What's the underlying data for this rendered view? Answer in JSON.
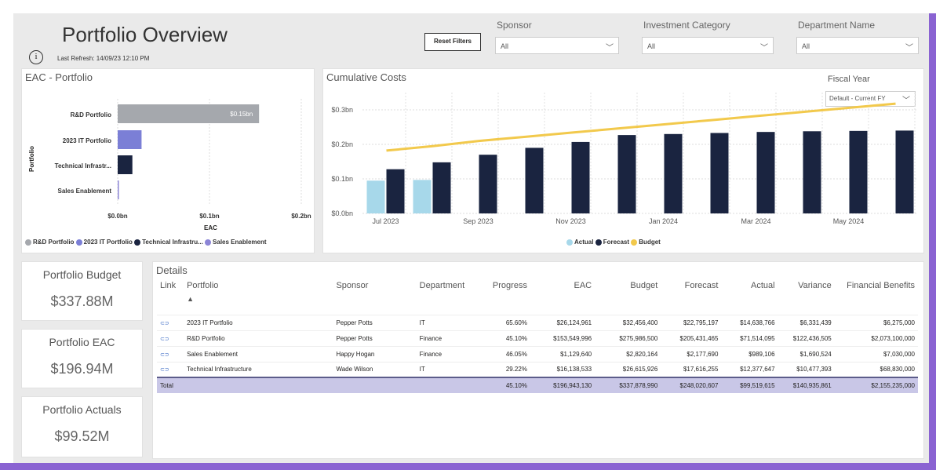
{
  "header": {
    "title": "Portfolio Overview",
    "last_refresh": "Last Refresh: 14/09/23 12:10 PM",
    "reset_label": "Reset Filters"
  },
  "slicers": [
    {
      "label": "Sponsor",
      "value": "All"
    },
    {
      "label": "Investment Category",
      "value": "All"
    },
    {
      "label": "Department Name",
      "value": "All"
    }
  ],
  "eac_panel": {
    "title": "EAC - Portfolio",
    "y_title": "Portfolio",
    "x_title": "EAC",
    "bar_label": "$0.15bn"
  },
  "cumulative_panel": {
    "title": "Cumulative Costs",
    "fiscal_label": "Fiscal Year",
    "fiscal_value": "Default - Current FY"
  },
  "kpis": [
    {
      "label": "Portfolio Budget",
      "value": "$337.88M"
    },
    {
      "label": "Portfolio EAC",
      "value": "$196.94M"
    },
    {
      "label": "Portfolio Actuals",
      "value": "$99.52M"
    }
  ],
  "details": {
    "title": "Details",
    "sort_arrow": "▲",
    "columns": [
      "Link",
      "Portfolio",
      "Sponsor",
      "Department",
      "Progress",
      "EAC",
      "Budget",
      "Forecast",
      "Actual",
      "Variance",
      "Financial Benefits"
    ],
    "rows": [
      [
        "2023 IT Portfolio",
        "Pepper Potts",
        "IT",
        "65.60%",
        "$26,124,961",
        "$32,456,400",
        "$22,795,197",
        "$14,638,766",
        "$6,331,439",
        "$6,275,000"
      ],
      [
        "R&D Portfolio",
        "Pepper Potts",
        "Finance",
        "45.10%",
        "$153,549,996",
        "$275,986,500",
        "$205,431,465",
        "$71,514,095",
        "$122,436,505",
        "$2,073,100,000"
      ],
      [
        "Sales Enablement",
        "Happy Hogan",
        "Finance",
        "46.05%",
        "$1,129,640",
        "$2,820,164",
        "$2,177,690",
        "$989,106",
        "$1,690,524",
        "$7,030,000"
      ],
      [
        "Technical Infrastructure",
        "Wade Wilson",
        "IT",
        "29.22%",
        "$16,138,533",
        "$26,615,926",
        "$17,616,255",
        "$12,377,647",
        "$10,477,393",
        "$68,830,000"
      ]
    ],
    "total": [
      "Total",
      "",
      "",
      "45.10%",
      "$196,943,130",
      "$337,878,990",
      "$248,020,607",
      "$99,519,615",
      "$140,935,861",
      "$2,155,235,000"
    ]
  },
  "colors": {
    "rd": "#a5a8ad",
    "it2023": "#7b7fd6",
    "tech": "#1a2440",
    "sales": "#8c85d6",
    "actual": "#a7d8ea",
    "forecast": "#1a2440",
    "budget": "#f2c94c"
  },
  "chart_data": [
    {
      "type": "bar",
      "orientation": "horizontal",
      "title": "EAC - Portfolio",
      "xlabel": "EAC",
      "ylabel": "Portfolio",
      "categories": [
        "R&D Portfolio",
        "2023 IT Portfolio",
        "Technical Infrastr...",
        "Sales Enablement"
      ],
      "values": [
        0.154,
        0.026,
        0.016,
        0.001
      ],
      "xticks": [
        "$0.0bn",
        "$0.1bn",
        "$0.2bn"
      ],
      "xlim": [
        0,
        0.2
      ],
      "legend": [
        "R&D Portfolio",
        "2023 IT Portfolio",
        "Technical Infrastru...",
        "Sales Enablement"
      ],
      "legend_placement": "bottom"
    },
    {
      "type": "bar",
      "title": "Cumulative Costs",
      "categories": [
        "Jul 2023",
        "Aug 2023",
        "Sep 2023",
        "Oct 2023",
        "Nov 2023",
        "Dec 2023",
        "Jan 2024",
        "Feb 2024",
        "Mar 2024",
        "Apr 2024",
        "May 2024",
        "Jun 2024"
      ],
      "xticks": [
        "Jul 2023",
        "Sep 2023",
        "Nov 2023",
        "Jan 2024",
        "Mar 2024",
        "May 2024"
      ],
      "yticks": [
        "$0.0bn",
        "$0.1bn",
        "$0.2bn",
        "$0.3bn"
      ],
      "ylim": [
        0,
        0.35
      ],
      "series": [
        {
          "name": "Actual",
          "type": "bar",
          "values": [
            0.095,
            0.097,
            null,
            null,
            null,
            null,
            null,
            null,
            null,
            null,
            null,
            null
          ]
        },
        {
          "name": "Forecast",
          "type": "bar",
          "values": [
            0.128,
            0.148,
            0.17,
            0.19,
            0.207,
            0.227,
            0.23,
            0.233,
            0.236,
            0.238,
            0.239,
            0.24
          ]
        },
        {
          "name": "Budget",
          "type": "line",
          "values": [
            0.182,
            0.195,
            0.21,
            0.222,
            0.234,
            0.246,
            0.258,
            0.27,
            0.282,
            0.294,
            0.306,
            0.318
          ]
        }
      ],
      "legend_placement": "bottom"
    }
  ]
}
